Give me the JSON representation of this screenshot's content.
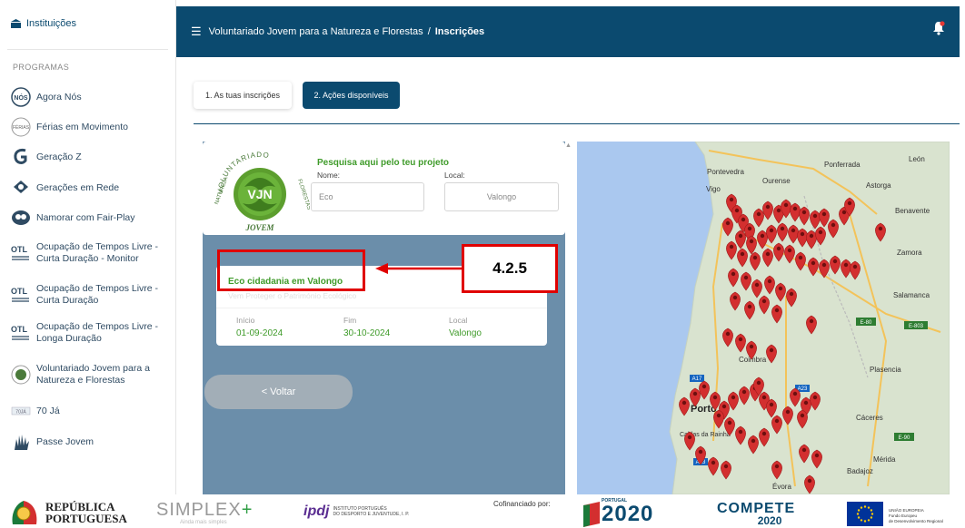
{
  "sidebar": {
    "institutions_label": "Instituições",
    "section_title": "PROGRAMAS",
    "items": [
      {
        "label": "Agora Nós",
        "icon": "agora-nos-logo-icon"
      },
      {
        "label": "Férias em Movimento",
        "icon": "ferias-logo-icon"
      },
      {
        "label": "Geração Z",
        "icon": "geracao-z-logo-icon"
      },
      {
        "label": "Gerações em Rede",
        "icon": "geracoes-rede-logo-icon"
      },
      {
        "label": "Namorar com Fair-Play",
        "icon": "fair-play-logo-icon"
      },
      {
        "label_line1": "Ocupação de Tempos Livre -",
        "label_line2": "Curta Duração - Monitor",
        "icon": "otl-logo-icon"
      },
      {
        "label_line1": "Ocupação de Tempos Livre -",
        "label_line2": "Curta Duração",
        "icon": "otl-logo-icon"
      },
      {
        "label_line1": "Ocupação de Tempos Livre -",
        "label_line2": "Longa Duração",
        "icon": "otl-logo-icon"
      },
      {
        "label_line1": "Voluntariado Jovem para a",
        "label_line2": "Natureza e Florestas",
        "icon": "vjnf-logo-icon"
      },
      {
        "label": "70 Já",
        "icon": "70-ja-logo-icon"
      },
      {
        "label": "Passe Jovem",
        "icon": "passe-jovem-logo-icon"
      }
    ]
  },
  "header": {
    "breadcrumb_parent": "Voluntariado Jovem para a Natureza e Florestas",
    "breadcrumb_separator": "/",
    "breadcrumb_current": "Inscrições",
    "color": "#0b4a6f"
  },
  "tabs": [
    {
      "label": "1. As tuas inscrições",
      "active": false
    },
    {
      "label": "2. Ações disponíveis",
      "active": true
    }
  ],
  "search": {
    "title": "Pesquisa aqui pelo teu projeto",
    "name_label": "Nome:",
    "name_value": "Eco",
    "local_label": "Local:",
    "local_value": "Valongo",
    "logo_text": "VOLUNTARIADO JOVEM NATUREZA FLORESTAS",
    "logo_initials": "VJN"
  },
  "result": {
    "title": "Eco cidadania em Valongo",
    "subtitle": "Vem Proteger o Património Ecológico",
    "start_label": "Início",
    "start_value": "01-09-2024",
    "end_label": "Fim",
    "end_value": "30-10-2024",
    "local_label": "Local",
    "local_value": "Valongo"
  },
  "back_button": "< Voltar",
  "annotation": {
    "label": "4.2.5",
    "color": "#e00000"
  },
  "map": {
    "places": [
      "Ponferrada",
      "León",
      "Pontevedra",
      "Ourense",
      "Astorga",
      "Vigo",
      "Benavente",
      "Zamora",
      "Salamanca",
      "Plasencia",
      "Cáceres",
      "Mérida",
      "Badajoz",
      "Porto",
      "Coimbra",
      "Caldas da Rainha",
      "Évora"
    ],
    "roads": [
      "E-80",
      "E-803",
      "A17",
      "A23",
      "E-90",
      "A13"
    ],
    "marker_color": "#d32f2f"
  },
  "footer": {
    "republica_line1": "REPÚBLICA",
    "republica_line2": "PORTUGUESA",
    "simplex": "SIMPLEX",
    "simplex_plus": "+",
    "simplex_sub": "Ainda mais simples",
    "ipdj_logo": "ipdj",
    "ipdj_line1": "INSTITUTO PORTUGUÊS",
    "ipdj_line2": "DO DESPORTO E JUVENTUDE, I. P.",
    "cofinanciado": "Cofinanciado por:",
    "portugal_label": "PORTUGAL",
    "portugal_year": "2020",
    "compete_word": "COMPETE",
    "compete_year": "2020",
    "eu_line1": "UNIÃO EUROPEIA",
    "eu_line2": "Fundo Europeu",
    "eu_line3": "de Desenvolvimento Regional"
  }
}
